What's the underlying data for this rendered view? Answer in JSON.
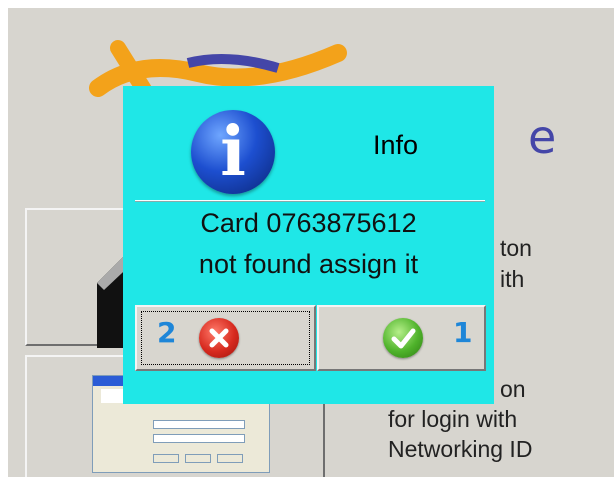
{
  "background": {
    "logo_suffix": "e",
    "button_1_text": [
      "ton",
      "ith"
    ],
    "button_2_text": [
      "on",
      "for login with",
      "Networking ID"
    ]
  },
  "dialog": {
    "title": "Info",
    "message_line_1": "Card 0763875612",
    "message_line_2": "not found assign it",
    "cancel_badge": "2",
    "ok_badge": "1",
    "icons": {
      "info": "info-icon",
      "cancel": "close-icon",
      "ok": "checkmark-icon"
    }
  },
  "colors": {
    "dialog_background": "#1fe7e7",
    "desktop_background": "#d7d5cf",
    "badge": "#1e86d8"
  }
}
